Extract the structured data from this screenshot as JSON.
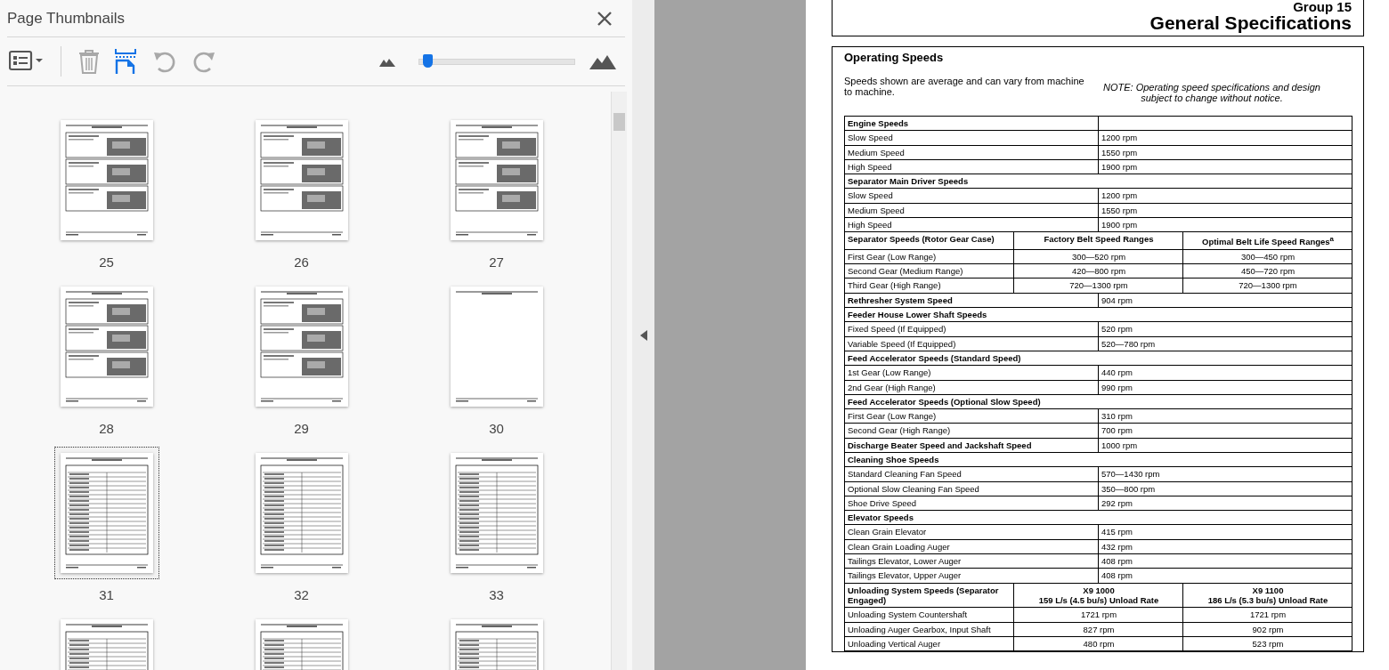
{
  "panel": {
    "title": "Page Thumbnails"
  },
  "toolbar": [
    {
      "kind": "options",
      "disabled": false
    },
    {
      "kind": "delete",
      "disabled": true
    },
    {
      "kind": "insert",
      "disabled": false
    },
    {
      "kind": "rotate_left",
      "disabled": true
    },
    {
      "kind": "rotate_right",
      "disabled": true
    }
  ],
  "zoom_slider": {
    "level": 0.03
  },
  "thumbnails": [
    {
      "label": "25",
      "kind": "photos",
      "selected": false
    },
    {
      "label": "26",
      "kind": "photos",
      "selected": false
    },
    {
      "label": "27",
      "kind": "photos",
      "selected": false
    },
    {
      "label": "28",
      "kind": "photos",
      "selected": false
    },
    {
      "label": "29",
      "kind": "photos",
      "selected": false
    },
    {
      "label": "30",
      "kind": "blank",
      "selected": false
    },
    {
      "label": "31",
      "kind": "table",
      "selected": true
    },
    {
      "label": "32",
      "kind": "table",
      "selected": false
    },
    {
      "label": "33",
      "kind": "table",
      "selected": false
    },
    {
      "kind": "table",
      "selected": false
    },
    {
      "kind": "table",
      "selected": false
    },
    {
      "kind": "table",
      "selected": false
    }
  ],
  "document": {
    "group": "Group 15",
    "title": "General Specifications",
    "section": "Operating Speeds",
    "intro": "Speeds shown are average and can vary from machine to machine.",
    "note": "NOTE: Operating speed specifications and design subject to change without notice.",
    "rows": [
      {
        "kind": "header_blank",
        "cells": [
          "Engine Speeds"
        ]
      },
      {
        "kind": "row",
        "cells": [
          "Slow Speed",
          "1200 rpm"
        ]
      },
      {
        "kind": "row",
        "cells": [
          "Medium Speed",
          "1550 rpm"
        ]
      },
      {
        "kind": "row",
        "cells": [
          "High Speed",
          "1900 rpm"
        ]
      },
      {
        "kind": "section",
        "cells": [
          "Separator Main Driver Speeds"
        ]
      },
      {
        "kind": "row",
        "cells": [
          "Slow Speed",
          "1200 rpm"
        ]
      },
      {
        "kind": "row",
        "cells": [
          "Medium Speed",
          "1550 rpm"
        ]
      },
      {
        "kind": "row",
        "cells": [
          "High Speed",
          "1900 rpm"
        ]
      },
      {
        "kind": "head",
        "cells": [
          "Separator Speeds (Rotor Gear Case)",
          "Factory Belt Speed Ranges",
          "Optimal Belt Life Speed Ranges$^{a}$"
        ]
      },
      {
        "kind": "row",
        "cells": [
          "First Gear (Low Range)",
          "300—520 rpm",
          "300—450 rpm"
        ]
      },
      {
        "kind": "row",
        "cells": [
          "Second Gear (Medium Range)",
          "420—800 rpm",
          "450—720 rpm"
        ]
      },
      {
        "kind": "row",
        "cells": [
          "Third Gear (High Range)",
          "720—1300 rpm",
          "720—1300 rpm"
        ]
      },
      {
        "kind": "bold_row",
        "cells": [
          "Rethresher System Speed",
          "904 rpm"
        ]
      },
      {
        "kind": "section",
        "cells": [
          "Feeder House Lower Shaft Speeds"
        ]
      },
      {
        "kind": "row",
        "cells": [
          "Fixed Speed (If Equipped)",
          "520 rpm"
        ]
      },
      {
        "kind": "row",
        "cells": [
          "Variable Speed (If Equipped)",
          "520—780 rpm"
        ]
      },
      {
        "kind": "section",
        "cells": [
          "Feed Accelerator Speeds (Standard Speed)"
        ]
      },
      {
        "kind": "row",
        "cells": [
          "1st Gear (Low Range)",
          "440 rpm"
        ]
      },
      {
        "kind": "row",
        "cells": [
          "2nd Gear (High Range)",
          "990 rpm"
        ]
      },
      {
        "kind": "section",
        "cells": [
          "Feed Accelerator Speeds (Optional Slow Speed)"
        ]
      },
      {
        "kind": "row",
        "cells": [
          "First Gear (Low Range)",
          "310 rpm"
        ]
      },
      {
        "kind": "row",
        "cells": [
          "Second Gear (High Range)",
          "700 rpm"
        ]
      },
      {
        "kind": "bold_row",
        "cells": [
          "Discharge Beater Speed and Jackshaft Speed",
          "1000 rpm"
        ]
      },
      {
        "kind": "section",
        "cells": [
          "Cleaning Shoe Speeds"
        ]
      },
      {
        "kind": "row",
        "cells": [
          "Standard Cleaning Fan Speed",
          "570—1430 rpm"
        ]
      },
      {
        "kind": "row",
        "cells": [
          "Optional Slow Cleaning Fan Speed",
          "350—800 rpm"
        ]
      },
      {
        "kind": "row",
        "cells": [
          "Shoe Drive Speed",
          "292 rpm"
        ]
      },
      {
        "kind": "section",
        "cells": [
          "Elevator Speeds"
        ]
      },
      {
        "kind": "row",
        "cells": [
          "Clean Grain Elevator",
          "415 rpm"
        ]
      },
      {
        "kind": "row",
        "cells": [
          "Clean Grain Loading Auger",
          "432 rpm"
        ]
      },
      {
        "kind": "row",
        "cells": [
          "Tailings Elevator, Lower Auger",
          "408 rpm"
        ]
      },
      {
        "kind": "row",
        "cells": [
          "Tailings Elevator, Upper Auger",
          "408 rpm"
        ]
      },
      {
        "kind": "head",
        "cells": [
          "Unloading System Speeds (Separator Engaged)",
          "X9 1000\n159 L/s (4.5 bu/s) Unload Rate",
          "X9 1100\n186 L/s (5.3 bu/s) Unload Rate"
        ]
      },
      {
        "kind": "row",
        "cells": [
          "Unloading System Countershaft",
          "1721 rpm",
          "1721 rpm"
        ]
      },
      {
        "kind": "row",
        "cells": [
          "Unloading Auger Gearbox, Input Shaft",
          "827 rpm",
          "902 rpm"
        ]
      },
      {
        "kind": "row",
        "cells": [
          "Unloading Vertical Auger",
          "480 rpm",
          "523 rpm"
        ]
      }
    ]
  }
}
